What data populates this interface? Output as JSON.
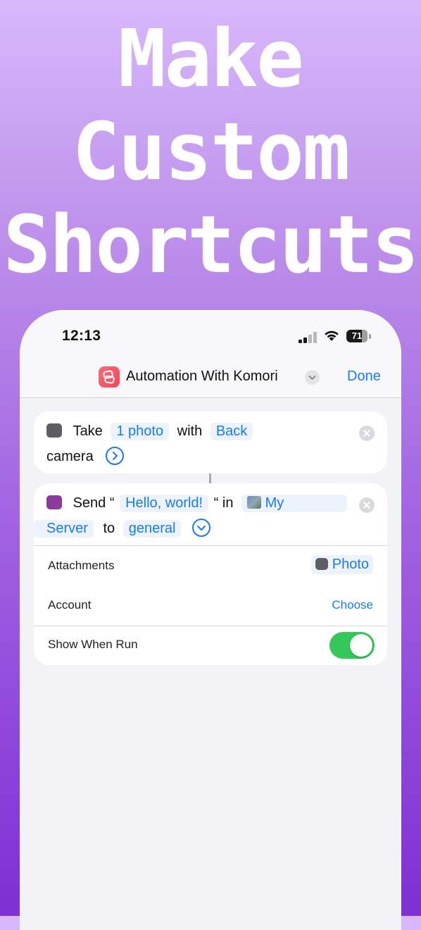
{
  "headline": {
    "line1": "Make",
    "line2": "Custom",
    "line3": "Shortcuts"
  },
  "status_bar": {
    "time": "12:13",
    "battery": "71"
  },
  "nav": {
    "title": "Automation With Komori",
    "done": "Done"
  },
  "take_action": {
    "verb": "Take",
    "count": "1 photo",
    "with": "with",
    "camera_position": "Back",
    "camera": "camera"
  },
  "send_action": {
    "verb": "Send “",
    "message": "Hello, world!",
    "in": "“ in",
    "server_1": "My",
    "server_2": "Server",
    "to": "to",
    "channel": "general"
  },
  "details": {
    "attachments_label": "Attachments",
    "attachments_value": "Photo",
    "account_label": "Account",
    "account_value": "Choose",
    "show_when_run_label": "Show When Run",
    "show_when_run_on": true
  },
  "colors": {
    "accent": "#1a7be8",
    "toggle_on": "#34c759",
    "app_icon": "#f2455a"
  },
  "icons": {
    "app": "shortcuts-icon",
    "camera": "camera-icon",
    "discord": "discord-bot-icon",
    "server": "server-thumbnail-icon",
    "remove": "close-circle-icon",
    "expand": "chevron-circle-icon"
  }
}
